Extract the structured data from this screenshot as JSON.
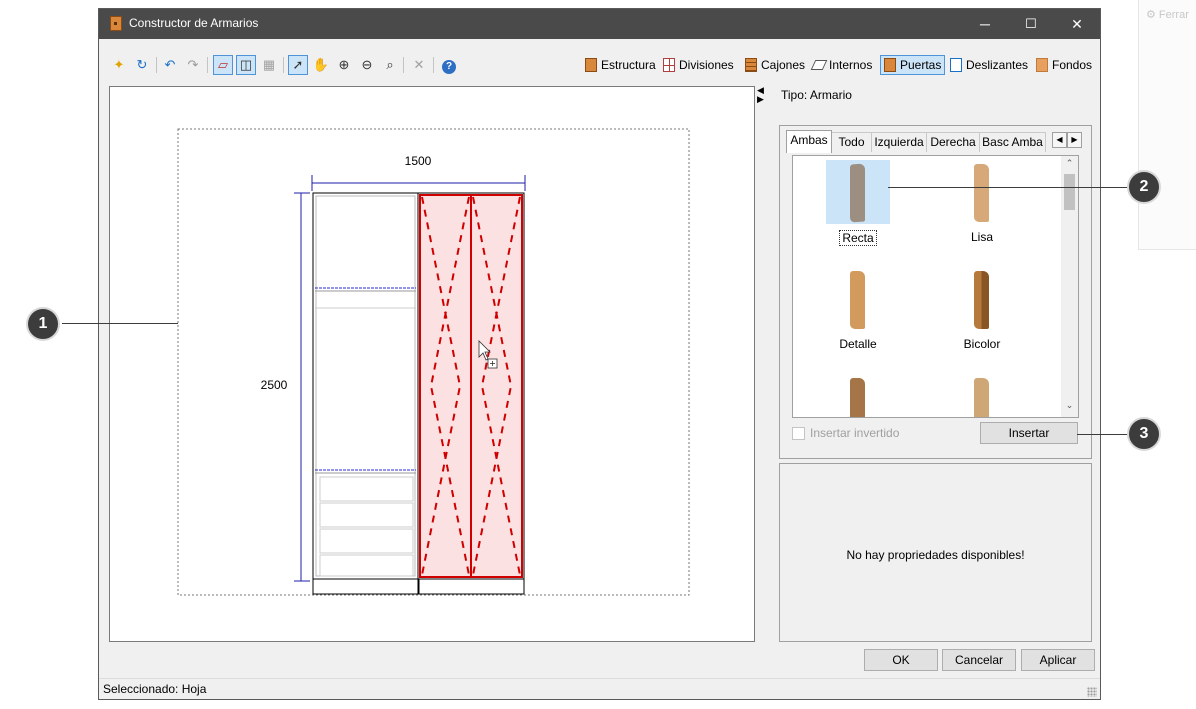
{
  "background_window": {
    "label": "Ferrar"
  },
  "window": {
    "title": "Constructor de Armarios",
    "controls": {
      "minimize": "─",
      "maximize": "☐",
      "close": "✕"
    }
  },
  "toolbar": {
    "tool_icons": [
      "new-icon",
      "refresh-icon",
      "undo-icon",
      "redo-icon",
      "view-mode-1-icon",
      "view-mode-2-icon",
      "grid-icon",
      "select-pointer-icon",
      "pan-hand-icon",
      "zoom-in-icon",
      "zoom-out-icon",
      "zoom-fit-icon",
      "delete-icon",
      "help-icon"
    ],
    "categories": [
      {
        "label": "Estructura",
        "active": false
      },
      {
        "label": "Divisiones",
        "active": false
      },
      {
        "label": "Cajones",
        "active": false
      },
      {
        "label": "Internos",
        "active": false
      },
      {
        "label": "Puertas",
        "active": true
      },
      {
        "label": "Deslizantes",
        "active": false
      },
      {
        "label": "Fondos",
        "active": false
      }
    ]
  },
  "drawing": {
    "width_dim": "1500",
    "height_dim": "2500",
    "colors": {
      "dimension": "#1c1ca8",
      "door": "#d00000",
      "door_fill": "#fbe1e1"
    }
  },
  "side_panel": {
    "tipo": "Tipo: Armario",
    "tabs": [
      "Ambas",
      "Todo",
      "Izquierda",
      "Derecha",
      "Basc Amba"
    ],
    "active_tab": "Ambas",
    "gallery": [
      {
        "label": "Recta",
        "selected": true,
        "color": "#9c8e80"
      },
      {
        "label": "Lisa",
        "selected": false,
        "color": "#d7a878"
      },
      {
        "label": "Detalle",
        "selected": false,
        "color": "#d39a5e"
      },
      {
        "label": "Bicolor",
        "selected": false,
        "color": "#b67a3c"
      },
      {
        "label": "",
        "selected": false,
        "color": "#a57548"
      },
      {
        "label": "",
        "selected": false,
        "color": "#cfa777"
      }
    ],
    "insert_inverted": {
      "label": "Insertar invertido",
      "checked": false,
      "enabled": false
    },
    "insert_button": "Insertar",
    "properties_message": "No hay propriedades disponibles!"
  },
  "footer": {
    "ok": "OK",
    "cancel": "Cancelar",
    "apply": "Aplicar",
    "status": "Seleccionado: Hoja"
  },
  "callouts": [
    "1",
    "2",
    "3"
  ]
}
